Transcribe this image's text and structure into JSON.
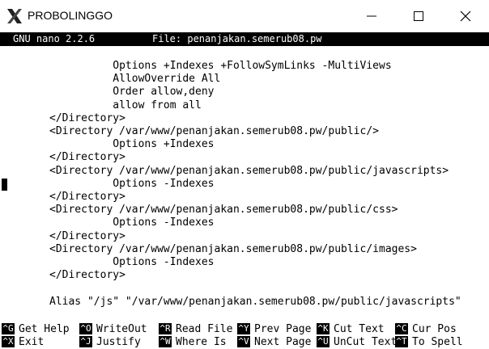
{
  "window": {
    "title": "PROBOLINGGO"
  },
  "nano": {
    "version": "GNU nano 2.2.6",
    "file_label": "File: penanjakan.semerub08.pw"
  },
  "editor_lines": [
    "          Options +Indexes +FollowSymLinks -MultiViews",
    "          AllowOverride All",
    "          Order allow,deny",
    "          allow from all",
    "</Directory>",
    "<Directory /var/www/penanjakan.semerub08.pw/public/>",
    "          Options +Indexes",
    "</Directory>",
    "<Directory /var/www/penanjakan.semerub08.pw/public/javascripts>",
    "          Options -Indexes",
    "</Directory>",
    "<Directory /var/www/penanjakan.semerub08.pw/public/css>",
    "          Options -Indexes",
    "</Directory>",
    "<Directory /var/www/penanjakan.semerub08.pw/public/images>",
    "          Options -Indexes",
    "</Directory>",
    "",
    "Alias \"/js\" \"/var/www/penanjakan.semerub08.pw/public/javascripts\""
  ],
  "shortcuts": [
    {
      "key": "^G",
      "label": "Get Help"
    },
    {
      "key": "^O",
      "label": "WriteOut"
    },
    {
      "key": "^R",
      "label": "Read File"
    },
    {
      "key": "^Y",
      "label": "Prev Page"
    },
    {
      "key": "^K",
      "label": "Cut Text"
    },
    {
      "key": "^C",
      "label": "Cur Pos"
    },
    {
      "key": "^X",
      "label": "Exit"
    },
    {
      "key": "^J",
      "label": "Justify"
    },
    {
      "key": "^W",
      "label": "Where Is"
    },
    {
      "key": "^V",
      "label": "Next Page"
    },
    {
      "key": "^U",
      "label": "UnCut Text"
    },
    {
      "key": "^T",
      "label": "To Spell"
    }
  ],
  "icons": {
    "app": "x-server-icon",
    "minimize": "minimize-icon",
    "maximize": "maximize-icon",
    "close": "close-icon"
  }
}
